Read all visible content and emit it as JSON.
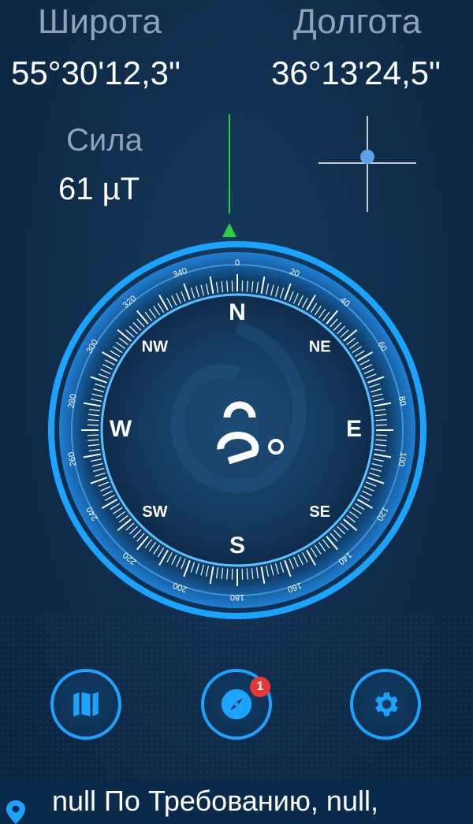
{
  "latitude": {
    "label": "Широта",
    "value": "55°30'12,3\""
  },
  "longitude": {
    "label": "Долгота",
    "value": "36°13'24,5\""
  },
  "field_strength": {
    "label": "Сила",
    "value": "61 µT"
  },
  "compass": {
    "heading_degrees": 0,
    "cardinals": [
      "N",
      "E",
      "S",
      "W"
    ],
    "intercardinals": [
      "NE",
      "SE",
      "SW",
      "NW"
    ],
    "degree_labels": [
      "0",
      "20",
      "40",
      "60",
      "80",
      "100",
      "120",
      "140",
      "160",
      "180",
      "200",
      "220",
      "240",
      "260",
      "280",
      "300",
      "320",
      "340"
    ],
    "accent_color": "#1aa3ff",
    "marker_color": "#2ecc40"
  },
  "buttons": {
    "map": {
      "icon": "map-icon"
    },
    "compass": {
      "icon": "compass-icon",
      "badge": "1"
    },
    "settings": {
      "icon": "gear-icon"
    }
  },
  "bottom_bar": {
    "icon": "location-pin-icon",
    "text": "null По Требованию, null,"
  }
}
